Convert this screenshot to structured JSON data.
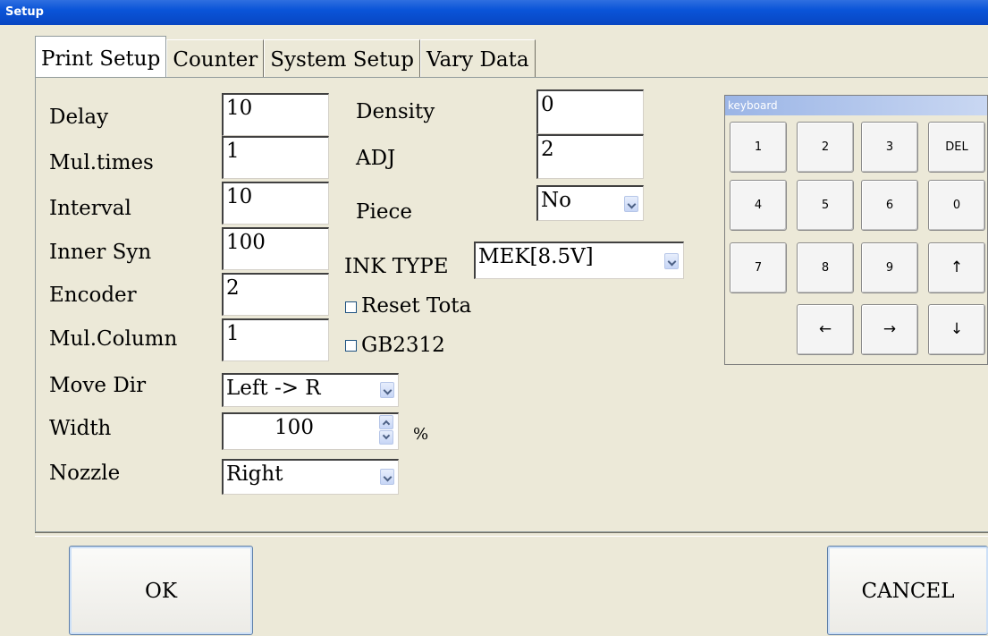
{
  "window": {
    "title": "Setup"
  },
  "tabs": [
    "Print Setup",
    "Counter",
    "System Setup",
    "Vary Data"
  ],
  "fields_left": [
    {
      "label": "Delay",
      "value": "10"
    },
    {
      "label": "Mul.times",
      "value": "1"
    },
    {
      "label": "Interval",
      "value": "10"
    },
    {
      "label": "Inner Syn",
      "value": "100"
    },
    {
      "label": "Encoder",
      "value": "2"
    },
    {
      "label": "Mul.Column",
      "value": "1"
    }
  ],
  "move_dir": {
    "label": "Move Dir",
    "value": "Left -> R"
  },
  "width": {
    "label": "Width",
    "value": "100",
    "unit": "%"
  },
  "nozzle": {
    "label": "Nozzle",
    "value": "Right"
  },
  "fields_mid": [
    {
      "label": "Density",
      "value": "0"
    },
    {
      "label": "ADJ",
      "value": "2"
    }
  ],
  "piece": {
    "label": "Piece",
    "value": "No"
  },
  "ink_type": {
    "label": "INK TYPE",
    "value": "MEK[8.5V]"
  },
  "checkboxes": [
    {
      "label": "Reset Tota",
      "checked": false
    },
    {
      "label": "GB2312",
      "checked": false
    }
  ],
  "keyboard": {
    "title": "keyboard",
    "keys": [
      "1",
      "2",
      "3",
      "DEL",
      "4",
      "5",
      "6",
      "0",
      "7",
      "8",
      "9",
      "↑",
      "←",
      "→",
      "↓"
    ]
  },
  "buttons": {
    "ok": "OK",
    "cancel": "CANCEL"
  }
}
